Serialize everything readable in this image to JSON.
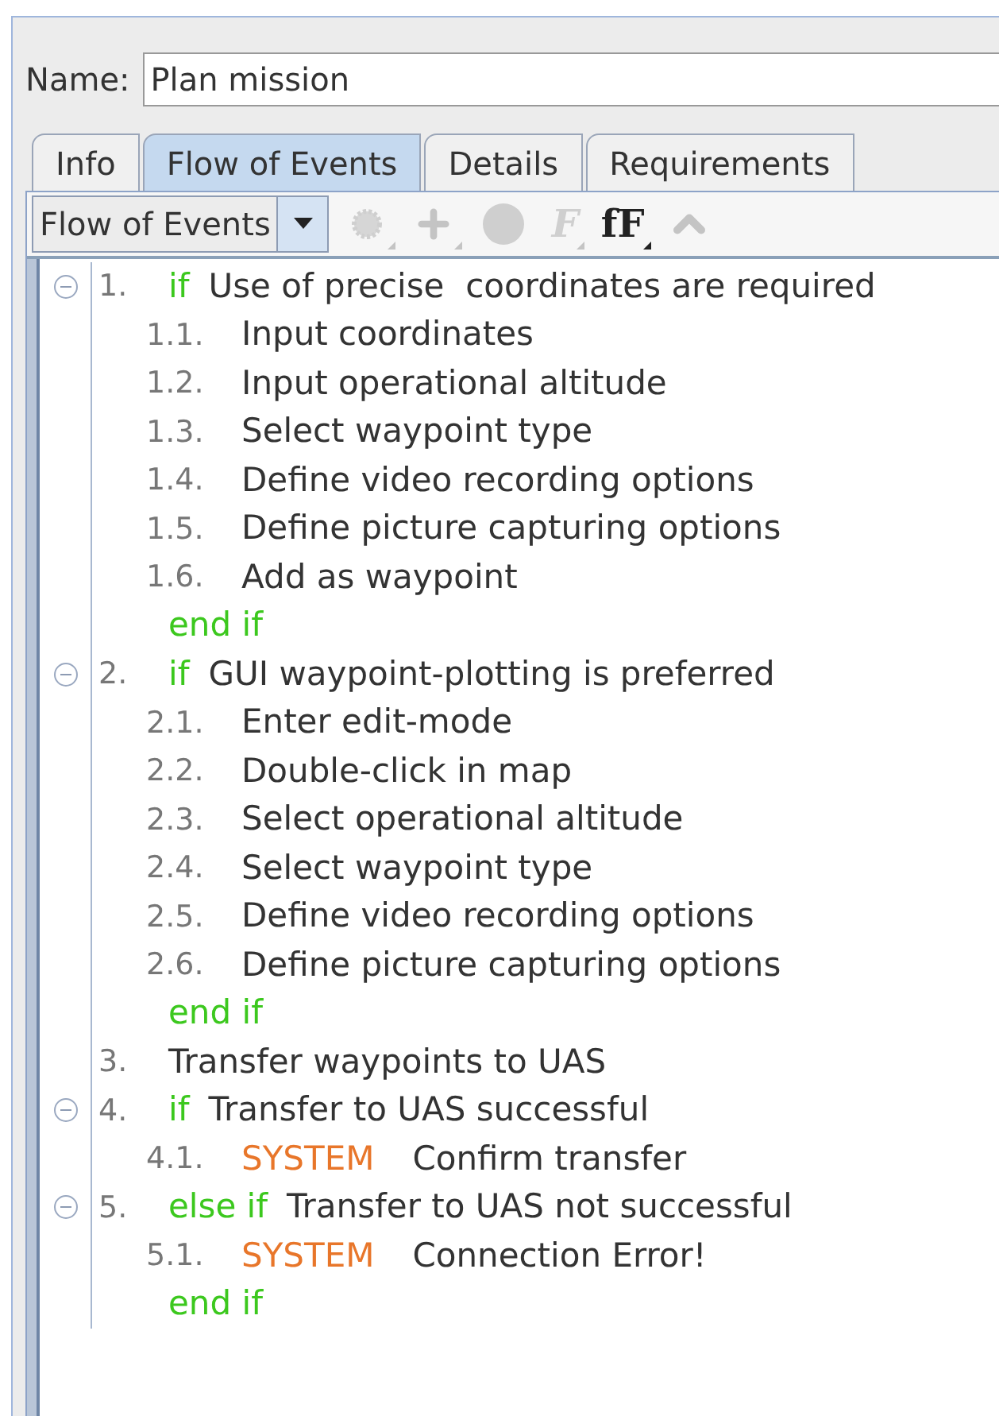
{
  "name_field": {
    "label": "Name:",
    "value": "Plan mission"
  },
  "tabs": [
    {
      "label": "Info",
      "selected": false
    },
    {
      "label": "Flow of Events",
      "selected": true
    },
    {
      "label": "Details",
      "selected": false
    },
    {
      "label": "Requirements",
      "selected": false
    }
  ],
  "toolbar": {
    "dropdown": "Flow of Events",
    "tools": [
      {
        "kind": "gear",
        "disabled": true
      },
      {
        "kind": "plus",
        "disabled": true
      },
      {
        "kind": "actor",
        "disabled": true
      },
      {
        "kind": "glyph",
        "glyph": "F",
        "disabled": true
      },
      {
        "kind": "glyph",
        "glyph": "fF",
        "disabled": false
      },
      {
        "kind": "up",
        "disabled": true
      }
    ]
  },
  "steps": [
    {
      "number": "1.",
      "keyword": "if",
      "text": "Use of precise  coordinates are required",
      "expanded": true,
      "end": "end if",
      "children": [
        {
          "number": "1.1.",
          "text": "Input coordinates"
        },
        {
          "number": "1.2.",
          "text": "Input operational altitude"
        },
        {
          "number": "1.3.",
          "text": "Select waypoint type"
        },
        {
          "number": "1.4.",
          "text": "Define video recording options"
        },
        {
          "number": "1.5.",
          "text": "Define picture capturing options"
        },
        {
          "number": "1.6.",
          "text": "Add as waypoint"
        }
      ]
    },
    {
      "number": "2.",
      "keyword": "if",
      "text": "GUI waypoint-plotting is preferred",
      "expanded": true,
      "end": "end if",
      "children": [
        {
          "number": "2.1.",
          "text": "Enter edit-mode"
        },
        {
          "number": "2.2.",
          "text": "Double-click in map"
        },
        {
          "number": "2.3.",
          "text": "Select operational altitude"
        },
        {
          "number": "2.4.",
          "text": "Select waypoint type"
        },
        {
          "number": "2.5.",
          "text": "Define video recording options"
        },
        {
          "number": "2.6.",
          "text": "Define picture capturing options"
        }
      ]
    },
    {
      "number": "3.",
      "text": "Transfer waypoints to UAS"
    },
    {
      "number": "4.",
      "keyword": "if",
      "text": "Transfer to UAS successful",
      "expanded": true,
      "children": [
        {
          "number": "4.1.",
          "actor": "SYSTEM",
          "text": "Confirm transfer"
        }
      ]
    },
    {
      "number": "5.",
      "keyword": "else if",
      "text": "Transfer to UAS not successful",
      "expanded": true,
      "end": "end if",
      "children": [
        {
          "number": "5.1.",
          "actor": "SYSTEM",
          "text": "Connection Error!"
        }
      ]
    }
  ]
}
